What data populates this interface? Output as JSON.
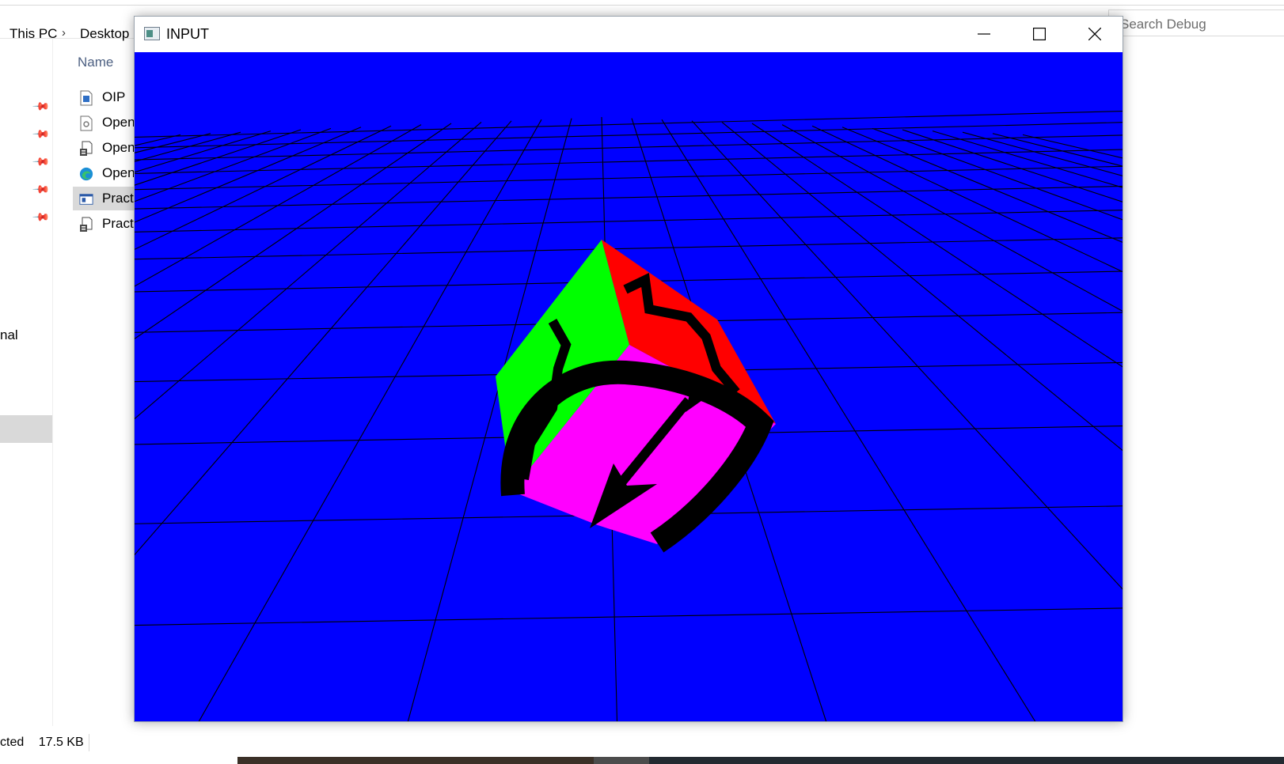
{
  "explorer": {
    "breadcrumb": [
      "This PC",
      "Desktop"
    ],
    "search_placeholder": "Search Debug",
    "column_header": "Name",
    "nav_partial_text": "nal",
    "files": [
      {
        "name": "OIP",
        "icon": "image-file-icon"
      },
      {
        "name": "Open",
        "icon": "config-file-icon"
      },
      {
        "name": "Open",
        "icon": "library-file-icon"
      },
      {
        "name": "Open",
        "icon": "edge-icon"
      },
      {
        "name": "Practi",
        "icon": "application-icon"
      },
      {
        "name": "Practi",
        "icon": "library-file-icon"
      }
    ],
    "status_selected": "cted",
    "status_size": "17.5 KB"
  },
  "app_window": {
    "title": "INPUT",
    "scene": {
      "background_color": "#0000ff",
      "grid_color": "#000000",
      "cube_faces": {
        "left": "#00ff00",
        "top": "#ff0000",
        "front": "#ff00ff"
      },
      "arrow_color": "#000000"
    }
  }
}
